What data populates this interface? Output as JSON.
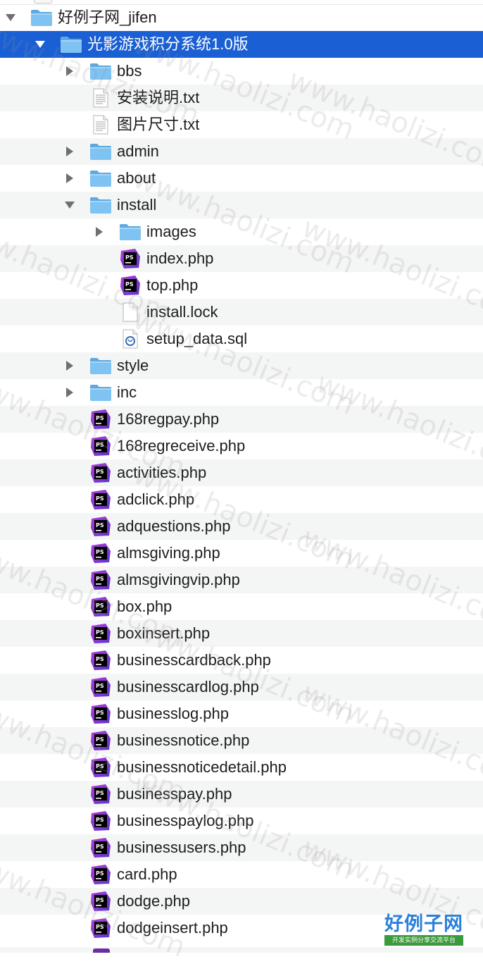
{
  "tree": [
    {
      "depth": 0,
      "disclosure": "open",
      "icon": "folder",
      "label": "好例子网_jifen"
    },
    {
      "depth": 1,
      "disclosure": "open",
      "icon": "folder",
      "label": "光影游戏积分系统1.0版",
      "selected": true
    },
    {
      "depth": 2,
      "disclosure": "closed",
      "icon": "folder",
      "label": "bbs"
    },
    {
      "depth": 2,
      "disclosure": "none",
      "icon": "text",
      "label": "安装说明.txt"
    },
    {
      "depth": 2,
      "disclosure": "none",
      "icon": "text",
      "label": "图片尺寸.txt"
    },
    {
      "depth": 2,
      "disclosure": "closed",
      "icon": "folder",
      "label": "admin"
    },
    {
      "depth": 2,
      "disclosure": "closed",
      "icon": "folder",
      "label": "about"
    },
    {
      "depth": 2,
      "disclosure": "open",
      "icon": "folder",
      "label": "install"
    },
    {
      "depth": 3,
      "disclosure": "closed",
      "icon": "folder",
      "label": "images"
    },
    {
      "depth": 3,
      "disclosure": "none",
      "icon": "php",
      "label": "index.php"
    },
    {
      "depth": 3,
      "disclosure": "none",
      "icon": "php",
      "label": "top.php"
    },
    {
      "depth": 3,
      "disclosure": "none",
      "icon": "blank",
      "label": "install.lock"
    },
    {
      "depth": 3,
      "disclosure": "none",
      "icon": "sql",
      "label": "setup_data.sql"
    },
    {
      "depth": 2,
      "disclosure": "closed",
      "icon": "folder",
      "label": "style"
    },
    {
      "depth": 2,
      "disclosure": "closed",
      "icon": "folder",
      "label": "inc"
    },
    {
      "depth": 2,
      "disclosure": "none",
      "icon": "php",
      "label": "168regpay.php"
    },
    {
      "depth": 2,
      "disclosure": "none",
      "icon": "php",
      "label": "168regreceive.php"
    },
    {
      "depth": 2,
      "disclosure": "none",
      "icon": "php",
      "label": "activities.php"
    },
    {
      "depth": 2,
      "disclosure": "none",
      "icon": "php",
      "label": "adclick.php"
    },
    {
      "depth": 2,
      "disclosure": "none",
      "icon": "php",
      "label": "adquestions.php"
    },
    {
      "depth": 2,
      "disclosure": "none",
      "icon": "php",
      "label": "almsgiving.php"
    },
    {
      "depth": 2,
      "disclosure": "none",
      "icon": "php",
      "label": "almsgivingvip.php"
    },
    {
      "depth": 2,
      "disclosure": "none",
      "icon": "php",
      "label": "box.php"
    },
    {
      "depth": 2,
      "disclosure": "none",
      "icon": "php",
      "label": "boxinsert.php"
    },
    {
      "depth": 2,
      "disclosure": "none",
      "icon": "php",
      "label": "businesscardback.php"
    },
    {
      "depth": 2,
      "disclosure": "none",
      "icon": "php",
      "label": "businesscardlog.php"
    },
    {
      "depth": 2,
      "disclosure": "none",
      "icon": "php",
      "label": "businesslog.php"
    },
    {
      "depth": 2,
      "disclosure": "none",
      "icon": "php",
      "label": "businessnotice.php"
    },
    {
      "depth": 2,
      "disclosure": "none",
      "icon": "php",
      "label": "businessnoticedetail.php"
    },
    {
      "depth": 2,
      "disclosure": "none",
      "icon": "php",
      "label": "businesspay.php"
    },
    {
      "depth": 2,
      "disclosure": "none",
      "icon": "php",
      "label": "businesspaylog.php"
    },
    {
      "depth": 2,
      "disclosure": "none",
      "icon": "php",
      "label": "businessusers.php"
    },
    {
      "depth": 2,
      "disclosure": "none",
      "icon": "php",
      "label": "card.php"
    },
    {
      "depth": 2,
      "disclosure": "none",
      "icon": "php",
      "label": "dodge.php"
    },
    {
      "depth": 2,
      "disclosure": "none",
      "icon": "php",
      "label": "dodgeinsert.php"
    }
  ],
  "php_badge": "PS",
  "watermark": "www.haolizi.com",
  "logo": {
    "title": "好例子网",
    "subtitle": "开发实例分享交流平台"
  },
  "colors": {
    "selection": "#1a5fd4",
    "folder": "#7ec3f2",
    "php_badge_top": "#b23bd9",
    "php_badge_bottom": "#5a36c9",
    "zebra": "#f4f5f5"
  }
}
